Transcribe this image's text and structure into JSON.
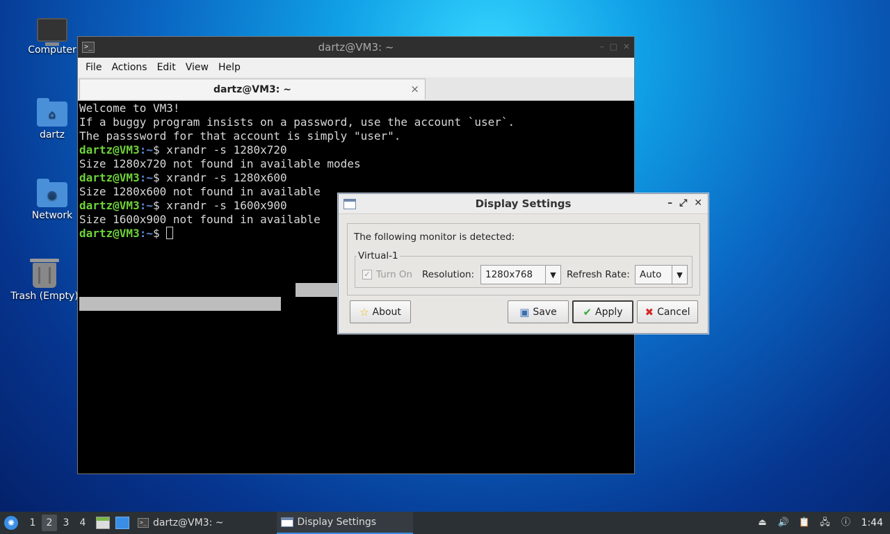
{
  "desktop": {
    "icons": [
      {
        "label": "Computer",
        "icon": "computer-icon"
      },
      {
        "label": "dartz",
        "icon": "home-folder-icon"
      },
      {
        "label": "Network",
        "icon": "network-folder-icon"
      },
      {
        "label": "Trash (Empty)",
        "icon": "trash-icon"
      }
    ]
  },
  "terminal": {
    "title": "dartz@VM3: ~",
    "menu": [
      "File",
      "Actions",
      "Edit",
      "View",
      "Help"
    ],
    "tab_label": "dartz@VM3: ~",
    "tab_close": "×",
    "lines": [
      "Welcome to VM3!",
      "If a buggy program insists on a password, use the account `user`.",
      "The passsword for that account is simply \"user\".",
      ""
    ],
    "prompt_user": "dartz@VM3",
    "prompt_path": ":~",
    "prompt_sign": "$ ",
    "commands": [
      {
        "cmd": "xrandr -s 1280x720",
        "output": "Size 1280x720 not found in available modes"
      },
      {
        "cmd": "xrandr -s 1280x600",
        "output": "Size 1280x600 not found in available "
      },
      {
        "cmd": "xrandr -s 1600x900",
        "output": "Size 1600x900 not found in available "
      }
    ]
  },
  "dialog": {
    "title": "Display Settings",
    "detected_text": "The following monitor is detected:",
    "monitor_name": "Virtual-1",
    "turn_on_label": "Turn On",
    "resolution_label": "Resolution:",
    "resolution_value": "1280x768",
    "refresh_label": "Refresh Rate:",
    "refresh_value": "Auto",
    "buttons": {
      "about": "About",
      "save": "Save",
      "apply": "Apply",
      "cancel": "Cancel"
    }
  },
  "taskbar": {
    "workspaces": [
      "1",
      "2",
      "3",
      "4"
    ],
    "active_workspace": "2",
    "tasks": [
      {
        "label": "dartz@VM3: ~",
        "icon": "terminal-icon"
      },
      {
        "label": "Display Settings",
        "icon": "window-icon"
      }
    ],
    "clock": "1:44"
  },
  "colors": {
    "prompt_user": "#6ed23a",
    "prompt_path": "#5b8bd6",
    "taskbar_bg": "#2b3034",
    "accent": "#3a8ee6"
  }
}
